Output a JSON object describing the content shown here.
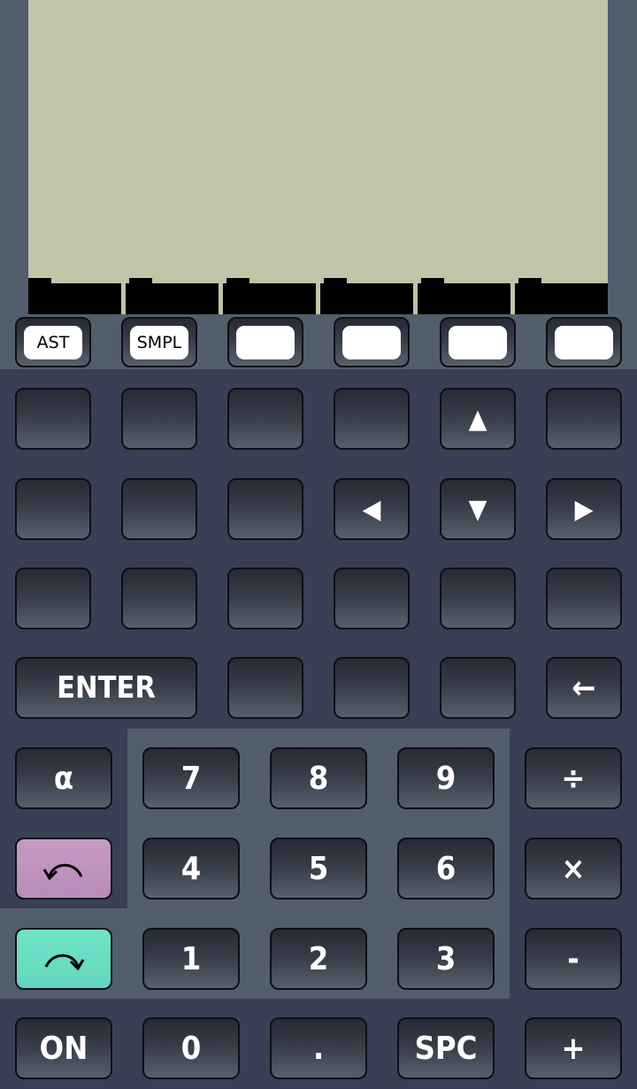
{
  "menu_keys": [
    "AST",
    "SMPL",
    "",
    "",
    "",
    ""
  ],
  "keys": {
    "up": "▲",
    "left": "◀",
    "down": "▼",
    "right": "▶",
    "enter": "ENTER",
    "backspace": "←",
    "alpha": "α",
    "undo_icon": "undo-arrow",
    "redo_icon": "redo-arrow",
    "n7": "7",
    "n8": "8",
    "n9": "9",
    "divide": "÷",
    "n4": "4",
    "n5": "5",
    "n6": "6",
    "multiply": "×",
    "n1": "1",
    "n2": "2",
    "n3": "3",
    "minus": "-",
    "on": "ON",
    "n0": "0",
    "dot": ".",
    "spc": "SPC",
    "plus": "+"
  },
  "colors": {
    "body": "#394055",
    "band": "#525e6c",
    "lcd": "#c0c4a8",
    "undo_key": "#c497c4",
    "redo_key": "#6fe3c9"
  }
}
